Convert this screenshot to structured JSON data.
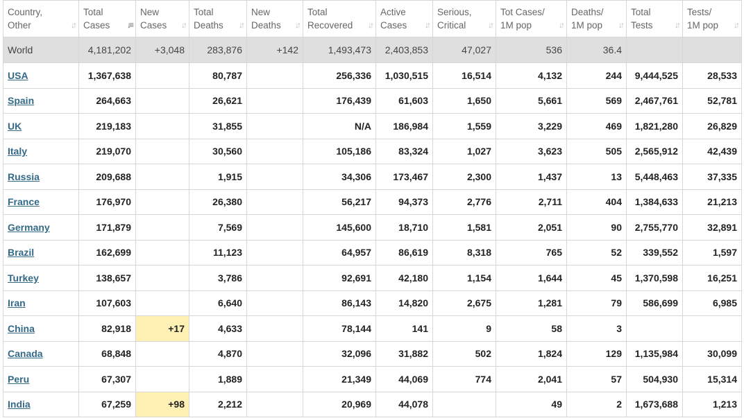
{
  "columns": [
    {
      "l1": "Country,",
      "l2": "Other",
      "sort_active": false
    },
    {
      "l1": "Total",
      "l2": "Cases",
      "sort_active": true
    },
    {
      "l1": "New",
      "l2": "Cases",
      "sort_active": false
    },
    {
      "l1": "Total",
      "l2": "Deaths",
      "sort_active": false
    },
    {
      "l1": "New",
      "l2": "Deaths",
      "sort_active": false
    },
    {
      "l1": "Total",
      "l2": "Recovered",
      "sort_active": false
    },
    {
      "l1": "Active",
      "l2": "Cases",
      "sort_active": false
    },
    {
      "l1": "Serious,",
      "l2": "Critical",
      "sort_active": false
    },
    {
      "l1": "Tot Cases/",
      "l2": "1M pop",
      "sort_active": false
    },
    {
      "l1": "Deaths/",
      "l2": "1M pop",
      "sort_active": false
    },
    {
      "l1": "Total",
      "l2": "Tests",
      "sort_active": false
    },
    {
      "l1": "Tests/",
      "l2": "1M pop",
      "sort_active": false
    }
  ],
  "sort_icon": "sort-arrows-icon",
  "highlight_color": "#fff0b3",
  "link_color": "#346987",
  "world": [
    "World",
    "4,181,202",
    "+3,048",
    "283,876",
    "+142",
    "1,493,473",
    "2,403,853",
    "47,027",
    "536",
    "36.4",
    "",
    ""
  ],
  "rows": [
    [
      "USA",
      "1,367,638",
      "",
      "80,787",
      "",
      "256,336",
      "1,030,515",
      "16,514",
      "4,132",
      "244",
      "9,444,525",
      "28,533"
    ],
    [
      "Spain",
      "264,663",
      "",
      "26,621",
      "",
      "176,439",
      "61,603",
      "1,650",
      "5,661",
      "569",
      "2,467,761",
      "52,781"
    ],
    [
      "UK",
      "219,183",
      "",
      "31,855",
      "",
      "N/A",
      "186,984",
      "1,559",
      "3,229",
      "469",
      "1,821,280",
      "26,829"
    ],
    [
      "Italy",
      "219,070",
      "",
      "30,560",
      "",
      "105,186",
      "83,324",
      "1,027",
      "3,623",
      "505",
      "2,565,912",
      "42,439"
    ],
    [
      "Russia",
      "209,688",
      "",
      "1,915",
      "",
      "34,306",
      "173,467",
      "2,300",
      "1,437",
      "13",
      "5,448,463",
      "37,335"
    ],
    [
      "France",
      "176,970",
      "",
      "26,380",
      "",
      "56,217",
      "94,373",
      "2,776",
      "2,711",
      "404",
      "1,384,633",
      "21,213"
    ],
    [
      "Germany",
      "171,879",
      "",
      "7,569",
      "",
      "145,600",
      "18,710",
      "1,581",
      "2,051",
      "90",
      "2,755,770",
      "32,891"
    ],
    [
      "Brazil",
      "162,699",
      "",
      "11,123",
      "",
      "64,957",
      "86,619",
      "8,318",
      "765",
      "52",
      "339,552",
      "1,597"
    ],
    [
      "Turkey",
      "138,657",
      "",
      "3,786",
      "",
      "92,691",
      "42,180",
      "1,154",
      "1,644",
      "45",
      "1,370,598",
      "16,251"
    ],
    [
      "Iran",
      "107,603",
      "",
      "6,640",
      "",
      "86,143",
      "14,820",
      "2,675",
      "1,281",
      "79",
      "586,699",
      "6,985"
    ],
    [
      "China",
      "82,918",
      "+17",
      "4,633",
      "",
      "78,144",
      "141",
      "9",
      "58",
      "3",
      "",
      ""
    ],
    [
      "Canada",
      "68,848",
      "",
      "4,870",
      "",
      "32,096",
      "31,882",
      "502",
      "1,824",
      "129",
      "1,135,984",
      "30,099"
    ],
    [
      "Peru",
      "67,307",
      "",
      "1,889",
      "",
      "21,349",
      "44,069",
      "774",
      "2,041",
      "57",
      "504,930",
      "15,314"
    ],
    [
      "India",
      "67,259",
      "+98",
      "2,212",
      "",
      "20,969",
      "44,078",
      "",
      "49",
      "2",
      "1,673,688",
      "1,213"
    ]
  ]
}
